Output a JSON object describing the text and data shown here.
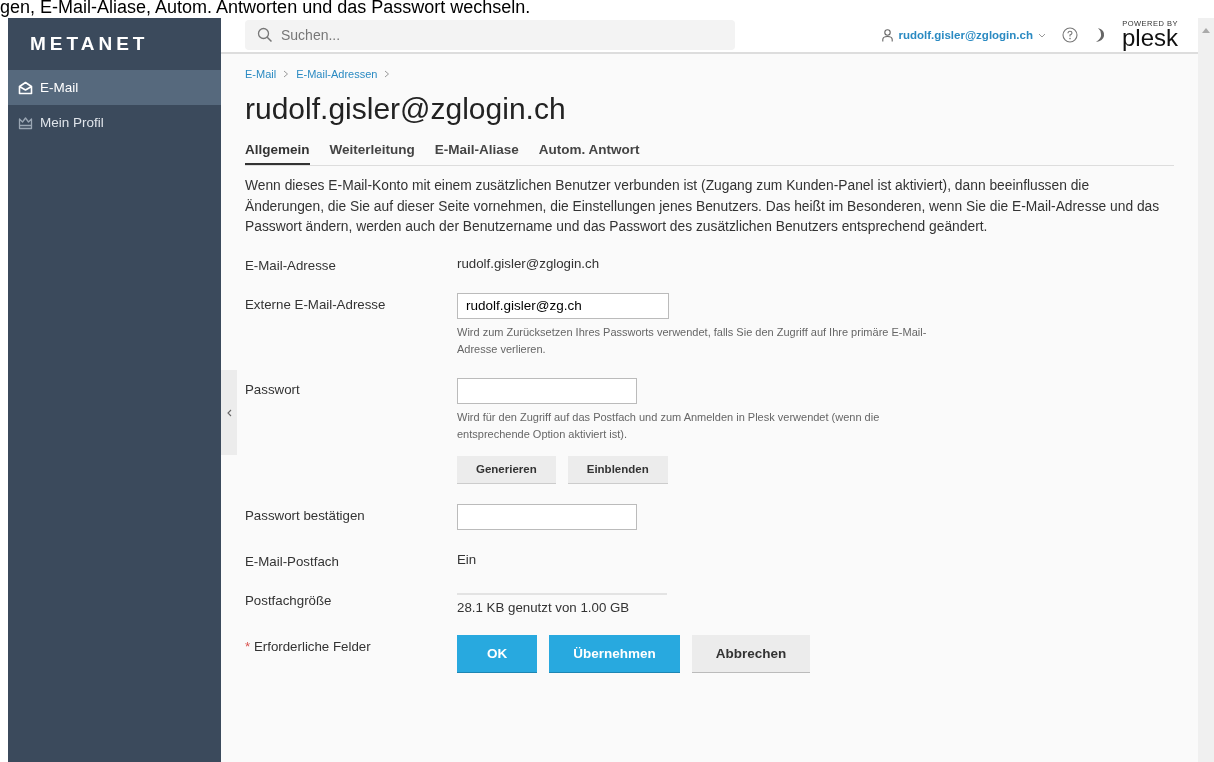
{
  "top_caption": "gen, E-Mail-Aliase, Autom. Antworten und das Passwort wechseln.",
  "sidebar": {
    "logo": "METANET",
    "items": [
      {
        "label": "E-Mail",
        "kind": "mail",
        "selected": true
      },
      {
        "label": "Mein Profil",
        "kind": "profile",
        "selected": false
      }
    ]
  },
  "header": {
    "search": {
      "placeholder": "Suchen..."
    },
    "user": "rudolf.gisler@zglogin.ch",
    "powered_by": "POWERED BY",
    "brand": "plesk"
  },
  "breadcrumbs": [
    "E-Mail",
    "E-Mail-Adressen"
  ],
  "title": "rudolf.gisler@zglogin.ch",
  "tabs": [
    {
      "label": "Allgemein",
      "selected": true
    },
    {
      "label": "Weiterleitung",
      "selected": false
    },
    {
      "label": "E-Mail-Aliase",
      "selected": false
    },
    {
      "label": "Autom. Antwort",
      "selected": false
    }
  ],
  "description": "Wenn dieses E-Mail-Konto mit einem zusätzlichen Benutzer verbunden ist (Zugang zum Kunden-Panel ist aktiviert), dann beeinflussen die Änderungen, die Sie auf dieser Seite vornehmen, die Einstellungen jenes Benutzers. Das heißt im Besonderen, wenn Sie die E-Mail-Adresse und das Passwort ändern, werden auch der Benutzername und das Passwort des zusätzlichen Benutzers entsprechend geändert.",
  "form": [
    {
      "kind": "text",
      "label": "E-Mail-Adresse",
      "value": "rudolf.gisler@zglogin.ch"
    },
    {
      "kind": "input",
      "label": "Externe E-Mail-Adresse",
      "value": "rudolf.gisler@zg.ch",
      "hint": "Wird zum Zurücksetzen Ihres Passworts verwendet, falls Sie den Zugriff auf Ihre primäre E-Mail-Adresse verlieren."
    },
    {
      "kind": "password",
      "label": "Passwort",
      "hint": "Wird für den Zugriff auf das Postfach und zum Anmelden in Plesk verwendet (wenn die entsprechende Option aktiviert ist).",
      "buttons": [
        "Generieren",
        "Einblenden"
      ]
    },
    {
      "kind": "password",
      "label": "Passwort bestätigen"
    },
    {
      "kind": "text",
      "label": "E-Mail-Postfach",
      "value": "Ein"
    },
    {
      "kind": "usage",
      "label": "Postfachgröße",
      "level": 0,
      "value": "28.1 KB genutzt von 1.00 GB"
    }
  ],
  "footer": {
    "required_mark": "*",
    "required_label": "Erforderliche Felder",
    "buttons": [
      {
        "label": "OK",
        "kind": "primary"
      },
      {
        "label": "Übernehmen",
        "kind": "primary"
      },
      {
        "label": "Abbrechen",
        "kind": "secondary"
      }
    ]
  }
}
